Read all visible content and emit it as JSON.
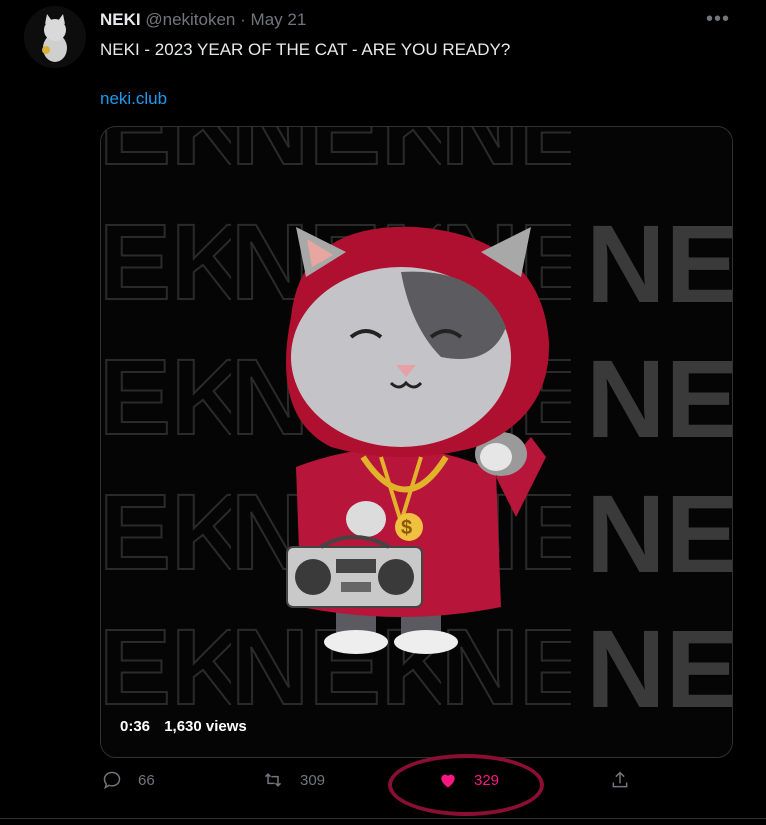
{
  "tweet": {
    "author_name": "NEKI",
    "handle": "@nekitoken",
    "separator": "·",
    "date": "May 21",
    "more_label": "•••",
    "text": "NEKI - 2023 YEAR OF THE CAT - ARE YOU READY?",
    "link": "neki.club"
  },
  "media": {
    "duration": "0:36",
    "views": "1,630 views",
    "watermark_text": "NEKI"
  },
  "actions": {
    "replies": "66",
    "retweets": "309",
    "likes": "329"
  },
  "colors": {
    "accent_link": "#1d9bf0",
    "like": "#f91880",
    "annotation_circle": "#8a0f33"
  }
}
